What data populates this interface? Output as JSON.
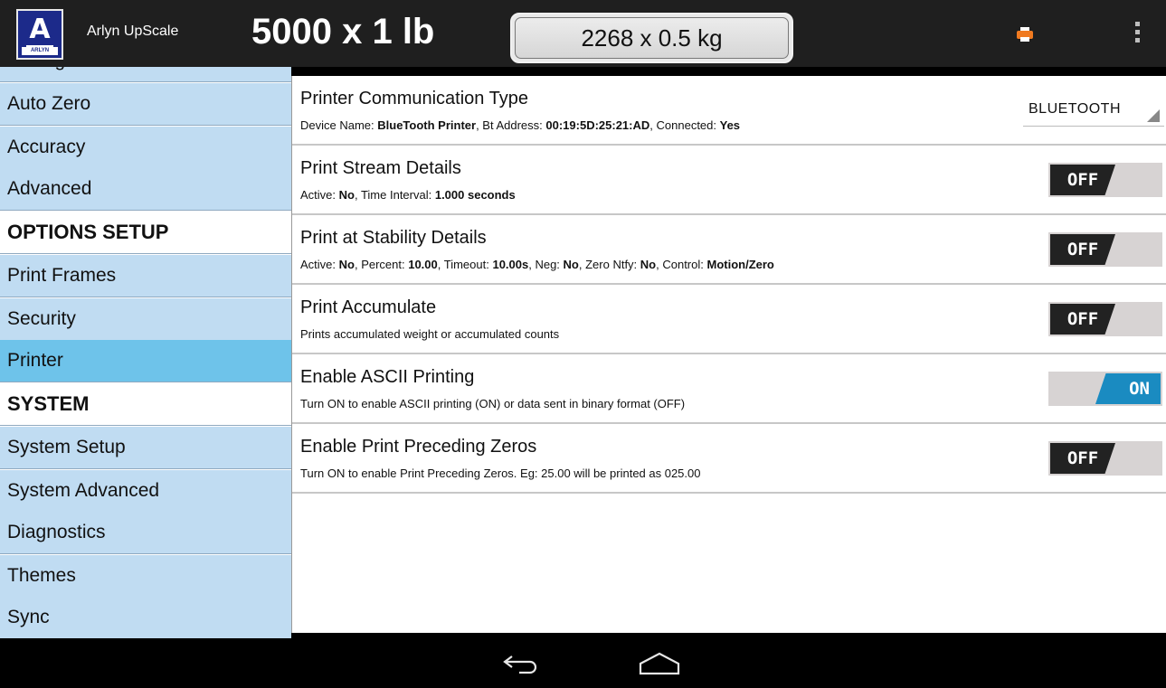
{
  "header": {
    "app_title": "Arlyn UpScale",
    "logo_letter": "A",
    "logo_text": "ARLYN",
    "capacity_lb": "5000 x 1 lb",
    "capacity_kg": "2268 x 0.5 kg",
    "printer_icon": "printer-icon",
    "overflow_icon": "overflow-menu-icon"
  },
  "sidebar": {
    "clipped_item": "Manage Units",
    "items": [
      {
        "label": "Auto Zero"
      },
      {
        "label": "Accuracy"
      },
      {
        "label": "Advanced"
      },
      {
        "label": "OPTIONS SETUP"
      },
      {
        "label": "Print Frames"
      },
      {
        "label": "Security"
      },
      {
        "label": "Printer"
      },
      {
        "label": "SYSTEM"
      },
      {
        "label": "System Setup"
      },
      {
        "label": "System Advanced"
      },
      {
        "label": "Diagnostics"
      },
      {
        "label": "Themes"
      },
      {
        "label": "Sync"
      }
    ]
  },
  "settings": {
    "comm": {
      "title": "Printer Communication Type",
      "desc_l1": "Device Name: ",
      "desc_v1": "BlueTooth Printer",
      "desc_l2": ", Bt Address: ",
      "desc_v2": "00:19:5D:25:21:AD",
      "desc_l3": ", Connected: ",
      "desc_v3": "Yes",
      "value": "BLUETOOTH"
    },
    "stream": {
      "title": "Print Stream Details",
      "desc_l1": "Active: ",
      "desc_v1": "No",
      "desc_l2": ", Time Interval: ",
      "desc_v2": "1.000 seconds",
      "toggle": "OFF"
    },
    "stability": {
      "title": "Print at Stability Details",
      "desc_l1": "Active: ",
      "desc_v1": "No",
      "desc_l2": ", Percent: ",
      "desc_v2": "10.00",
      "desc_l3": ", Timeout: ",
      "desc_v3": "10.00s",
      "desc_l4": ", Neg: ",
      "desc_v4": "No",
      "desc_l5": ", Zero Ntfy: ",
      "desc_v5": "No",
      "desc_l6": ", Control: ",
      "desc_v6": "Motion/Zero",
      "toggle": "OFF"
    },
    "accumulate": {
      "title": "Print Accumulate",
      "desc": "Prints accumulated weight or accumulated counts",
      "toggle": "OFF"
    },
    "ascii": {
      "title": "Enable ASCII Printing",
      "desc": "Turn ON to enable ASCII printing (ON) or data sent in binary format (OFF)",
      "toggle": "ON"
    },
    "zeros": {
      "title": "Enable Print Preceding Zeros",
      "desc": "Turn ON to enable Print Preceding Zeros. Eg: 25.00 will be printed as 025.00",
      "toggle": "OFF"
    }
  },
  "navbar": {
    "back_icon": "back-icon",
    "home_icon": "home-icon"
  },
  "colors": {
    "sidebar_bg": "#c0dcf2",
    "sidebar_selected": "#6ec3ea",
    "toggle_on": "#1a8bc1",
    "toggle_off": "#222222",
    "topbar": "#1f1f1f",
    "logo_bg": "#1c2a8a",
    "printer_icon": "#f07a20"
  }
}
